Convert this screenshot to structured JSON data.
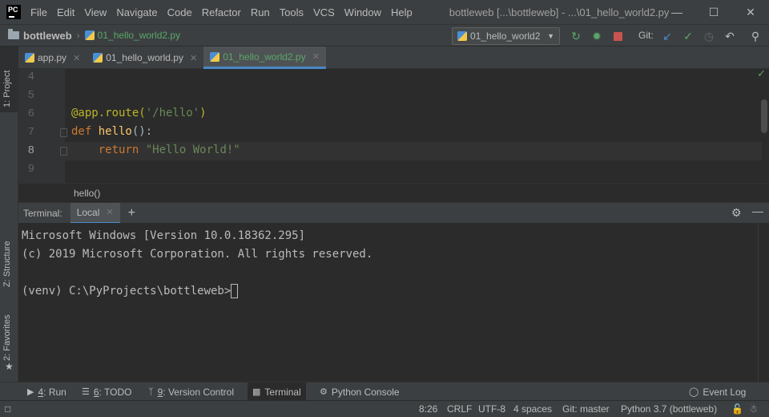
{
  "menu": [
    "File",
    "Edit",
    "View",
    "Navigate",
    "Code",
    "Refactor",
    "Run",
    "Tools",
    "VCS",
    "Window",
    "Help"
  ],
  "window_title": "bottleweb [...\\bottleweb] - ...\\01_hello_world2.py",
  "navbar": {
    "project": "bottleweb",
    "file": "01_hello_world2.py",
    "run_config": "01_hello_world2",
    "git_label": "Git:"
  },
  "tabs": [
    {
      "label": "app.py"
    },
    {
      "label": "01_hello_world.py"
    },
    {
      "label": "01_hello_world2.py",
      "active": true
    }
  ],
  "editor": {
    "lines": [
      {
        "num": "4"
      },
      {
        "num": "5"
      },
      {
        "num": "6",
        "decorator": "@app.route(",
        "string": "'/hello'",
        "close": ")"
      },
      {
        "num": "7",
        "keyword": "def ",
        "func": "hello",
        "rest": "():"
      },
      {
        "num": "8",
        "indent": "    ",
        "keyword": "return ",
        "string": "\"Hello World!\""
      },
      {
        "num": "9"
      }
    ],
    "breadcrumb": "hello()"
  },
  "terminal": {
    "title": "Terminal:",
    "tab": "Local",
    "lines": [
      "Microsoft Windows [Version 10.0.18362.295]",
      "(c) 2019 Microsoft Corporation. All rights reserved.",
      "",
      "(venv) C:\\PyProjects\\bottleweb>"
    ]
  },
  "side_tools": {
    "project": "1: Project",
    "structure": "Z: Structure",
    "favorites": "2: Favorites"
  },
  "bottom_tools": [
    {
      "mnemonic": "4",
      "label": ": Run"
    },
    {
      "mnemonic": "6",
      "label": ": TODO"
    },
    {
      "mnemonic": "9",
      "label": ": Version Control"
    },
    {
      "mnemonic": "",
      "label": "Terminal"
    },
    {
      "mnemonic": "",
      "label": "Python Console"
    }
  ],
  "event_log": "Event Log",
  "status": {
    "position": "8:26",
    "line_sep": "CRLF",
    "encoding": "UTF-8",
    "indent": "4 spaces",
    "git": "Git: master",
    "interpreter": "Python 3.7 (bottleweb)"
  },
  "colors": {
    "accent": "#4a88c7",
    "keyword": "#cc7832",
    "string": "#6a8759",
    "decorator": "#bbb529",
    "function": "#ffc66d",
    "green": "#59a869"
  }
}
